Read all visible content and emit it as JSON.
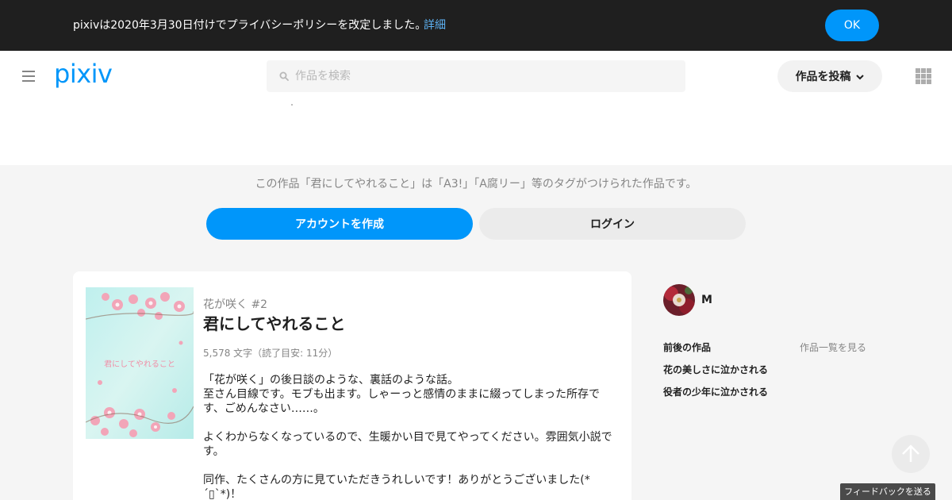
{
  "notice": {
    "text": "pixivは2020年3月30日付けでプライバシーポリシーを改定しました。",
    "link": "詳細",
    "ok_label": "OK"
  },
  "header": {
    "logo": "pixiv",
    "search_placeholder": "作品を検索",
    "post_label": "作品を投稿"
  },
  "tags": {
    "text": "この作品「君にしてやれること」は「A3!」「A腐リー」等のタグがつけられた作品です。",
    "create_account": "アカウントを作成",
    "login": "ログイン"
  },
  "work": {
    "cover_caption": "君にしてやれること",
    "series": "花が咲く #2",
    "title": "君にしてやれること",
    "meta": "5,578 文字（読了目安: 11分）",
    "description": [
      "「花が咲く」の後日談のような、裏話のような話。",
      "至さん目線です。モブも出ます。しゃーっと感情のままに綴ってしまった所存です、ごめんなさい……。",
      "よくわからなくなっているので、生暖かい目で見てやってください。雰囲気小説です。",
      "同作、たくさんの方に見ていただきうれしいです！ありがとうございました(*´▯`*)！"
    ]
  },
  "author": {
    "name": "M"
  },
  "nav": {
    "heading": "前後の作品",
    "view_all": "作品一覧を見る",
    "items": [
      "花の美しさに泣かされる",
      "役者の少年に泣かされる"
    ]
  },
  "feedback": "フィードバックを送る",
  "colors": {
    "accent": "#0096fa",
    "notice_bg": "#1f1f1f"
  }
}
